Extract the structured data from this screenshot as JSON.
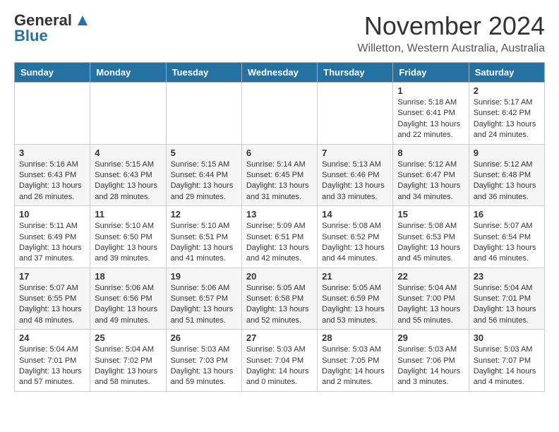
{
  "header": {
    "logo_general": "General",
    "logo_blue": "Blue",
    "month_title": "November 2024",
    "location": "Willetton, Western Australia, Australia"
  },
  "weekdays": [
    "Sunday",
    "Monday",
    "Tuesday",
    "Wednesday",
    "Thursday",
    "Friday",
    "Saturday"
  ],
  "weeks": [
    [
      {
        "day": "",
        "info": ""
      },
      {
        "day": "",
        "info": ""
      },
      {
        "day": "",
        "info": ""
      },
      {
        "day": "",
        "info": ""
      },
      {
        "day": "",
        "info": ""
      },
      {
        "day": "1",
        "info": "Sunrise: 5:18 AM\nSunset: 6:41 PM\nDaylight: 13 hours\nand 22 minutes."
      },
      {
        "day": "2",
        "info": "Sunrise: 5:17 AM\nSunset: 6:42 PM\nDaylight: 13 hours\nand 24 minutes."
      }
    ],
    [
      {
        "day": "3",
        "info": "Sunrise: 5:16 AM\nSunset: 6:43 PM\nDaylight: 13 hours\nand 26 minutes."
      },
      {
        "day": "4",
        "info": "Sunrise: 5:15 AM\nSunset: 6:43 PM\nDaylight: 13 hours\nand 28 minutes."
      },
      {
        "day": "5",
        "info": "Sunrise: 5:15 AM\nSunset: 6:44 PM\nDaylight: 13 hours\nand 29 minutes."
      },
      {
        "day": "6",
        "info": "Sunrise: 5:14 AM\nSunset: 6:45 PM\nDaylight: 13 hours\nand 31 minutes."
      },
      {
        "day": "7",
        "info": "Sunrise: 5:13 AM\nSunset: 6:46 PM\nDaylight: 13 hours\nand 33 minutes."
      },
      {
        "day": "8",
        "info": "Sunrise: 5:12 AM\nSunset: 6:47 PM\nDaylight: 13 hours\nand 34 minutes."
      },
      {
        "day": "9",
        "info": "Sunrise: 5:12 AM\nSunset: 6:48 PM\nDaylight: 13 hours\nand 36 minutes."
      }
    ],
    [
      {
        "day": "10",
        "info": "Sunrise: 5:11 AM\nSunset: 6:49 PM\nDaylight: 13 hours\nand 37 minutes."
      },
      {
        "day": "11",
        "info": "Sunrise: 5:10 AM\nSunset: 6:50 PM\nDaylight: 13 hours\nand 39 minutes."
      },
      {
        "day": "12",
        "info": "Sunrise: 5:10 AM\nSunset: 6:51 PM\nDaylight: 13 hours\nand 41 minutes."
      },
      {
        "day": "13",
        "info": "Sunrise: 5:09 AM\nSunset: 6:51 PM\nDaylight: 13 hours\nand 42 minutes."
      },
      {
        "day": "14",
        "info": "Sunrise: 5:08 AM\nSunset: 6:52 PM\nDaylight: 13 hours\nand 44 minutes."
      },
      {
        "day": "15",
        "info": "Sunrise: 5:08 AM\nSunset: 6:53 PM\nDaylight: 13 hours\nand 45 minutes."
      },
      {
        "day": "16",
        "info": "Sunrise: 5:07 AM\nSunset: 6:54 PM\nDaylight: 13 hours\nand 46 minutes."
      }
    ],
    [
      {
        "day": "17",
        "info": "Sunrise: 5:07 AM\nSunset: 6:55 PM\nDaylight: 13 hours\nand 48 minutes."
      },
      {
        "day": "18",
        "info": "Sunrise: 5:06 AM\nSunset: 6:56 PM\nDaylight: 13 hours\nand 49 minutes."
      },
      {
        "day": "19",
        "info": "Sunrise: 5:06 AM\nSunset: 6:57 PM\nDaylight: 13 hours\nand 51 minutes."
      },
      {
        "day": "20",
        "info": "Sunrise: 5:05 AM\nSunset: 6:58 PM\nDaylight: 13 hours\nand 52 minutes."
      },
      {
        "day": "21",
        "info": "Sunrise: 5:05 AM\nSunset: 6:59 PM\nDaylight: 13 hours\nand 53 minutes."
      },
      {
        "day": "22",
        "info": "Sunrise: 5:04 AM\nSunset: 7:00 PM\nDaylight: 13 hours\nand 55 minutes."
      },
      {
        "day": "23",
        "info": "Sunrise: 5:04 AM\nSunset: 7:01 PM\nDaylight: 13 hours\nand 56 minutes."
      }
    ],
    [
      {
        "day": "24",
        "info": "Sunrise: 5:04 AM\nSunset: 7:01 PM\nDaylight: 13 hours\nand 57 minutes."
      },
      {
        "day": "25",
        "info": "Sunrise: 5:04 AM\nSunset: 7:02 PM\nDaylight: 13 hours\nand 58 minutes."
      },
      {
        "day": "26",
        "info": "Sunrise: 5:03 AM\nSunset: 7:03 PM\nDaylight: 13 hours\nand 59 minutes."
      },
      {
        "day": "27",
        "info": "Sunrise: 5:03 AM\nSunset: 7:04 PM\nDaylight: 14 hours\nand 0 minutes."
      },
      {
        "day": "28",
        "info": "Sunrise: 5:03 AM\nSunset: 7:05 PM\nDaylight: 14 hours\nand 2 minutes."
      },
      {
        "day": "29",
        "info": "Sunrise: 5:03 AM\nSunset: 7:06 PM\nDaylight: 14 hours\nand 3 minutes."
      },
      {
        "day": "30",
        "info": "Sunrise: 5:03 AM\nSunset: 7:07 PM\nDaylight: 14 hours\nand 4 minutes."
      }
    ]
  ]
}
